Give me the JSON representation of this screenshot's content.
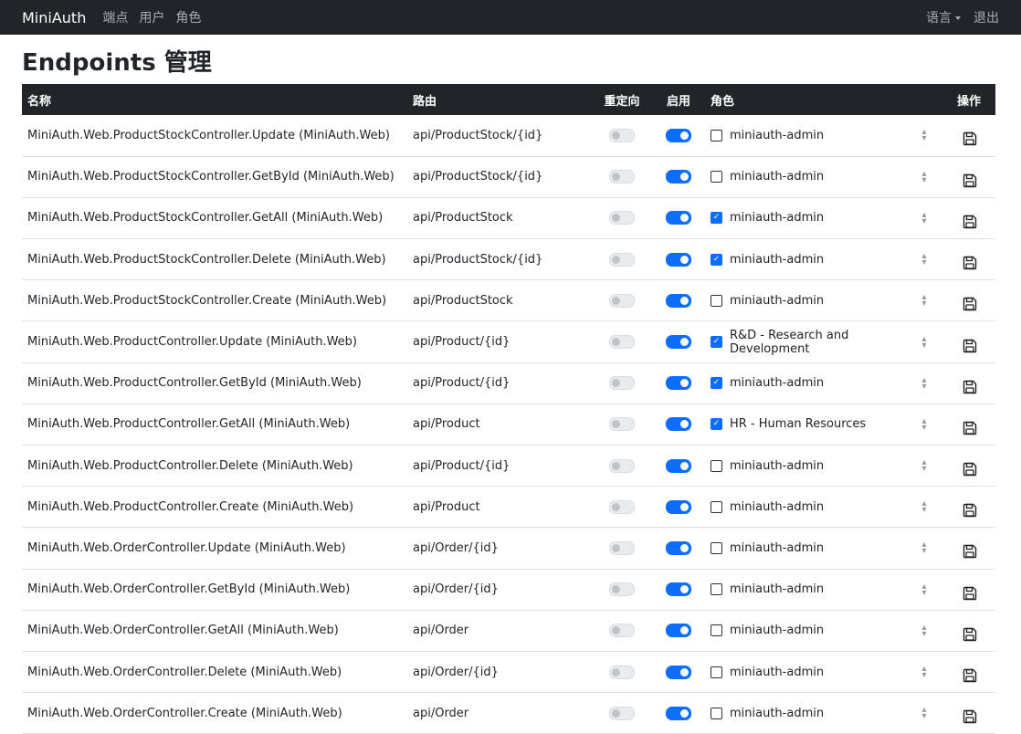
{
  "nav": {
    "brand": "MiniAuth",
    "links": [
      "端点",
      "用户",
      "角色"
    ],
    "language": "语言",
    "logout": "退出"
  },
  "page_title": "Endpoints 管理",
  "table": {
    "headers": {
      "name": "名称",
      "route": "路由",
      "redirect": "重定向",
      "enable": "启用",
      "role": "角色",
      "action": "操作"
    },
    "rows": [
      {
        "name": "MiniAuth.Web.ProductStockController.Update (MiniAuth.Web)",
        "route": "api/ProductStock/{id}",
        "redirect": false,
        "enabled": true,
        "role_checked": false,
        "role": "miniauth-admin"
      },
      {
        "name": "MiniAuth.Web.ProductStockController.GetById (MiniAuth.Web)",
        "route": "api/ProductStock/{id}",
        "redirect": false,
        "enabled": true,
        "role_checked": false,
        "role": "miniauth-admin"
      },
      {
        "name": "MiniAuth.Web.ProductStockController.GetAll (MiniAuth.Web)",
        "route": "api/ProductStock",
        "redirect": false,
        "enabled": true,
        "role_checked": true,
        "role": "miniauth-admin"
      },
      {
        "name": "MiniAuth.Web.ProductStockController.Delete (MiniAuth.Web)",
        "route": "api/ProductStock/{id}",
        "redirect": false,
        "enabled": true,
        "role_checked": true,
        "role": "miniauth-admin"
      },
      {
        "name": "MiniAuth.Web.ProductStockController.Create (MiniAuth.Web)",
        "route": "api/ProductStock",
        "redirect": false,
        "enabled": true,
        "role_checked": false,
        "role": "miniauth-admin"
      },
      {
        "name": "MiniAuth.Web.ProductController.Update (MiniAuth.Web)",
        "route": "api/Product/{id}",
        "redirect": false,
        "enabled": true,
        "role_checked": true,
        "role": "R&D - Research and Development"
      },
      {
        "name": "MiniAuth.Web.ProductController.GetById (MiniAuth.Web)",
        "route": "api/Product/{id}",
        "redirect": false,
        "enabled": true,
        "role_checked": true,
        "role": "miniauth-admin"
      },
      {
        "name": "MiniAuth.Web.ProductController.GetAll (MiniAuth.Web)",
        "route": "api/Product",
        "redirect": false,
        "enabled": true,
        "role_checked": true,
        "role": "HR - Human Resources"
      },
      {
        "name": "MiniAuth.Web.ProductController.Delete (MiniAuth.Web)",
        "route": "api/Product/{id}",
        "redirect": false,
        "enabled": true,
        "role_checked": false,
        "role": "miniauth-admin"
      },
      {
        "name": "MiniAuth.Web.ProductController.Create (MiniAuth.Web)",
        "route": "api/Product",
        "redirect": false,
        "enabled": true,
        "role_checked": false,
        "role": "miniauth-admin"
      },
      {
        "name": "MiniAuth.Web.OrderController.Update (MiniAuth.Web)",
        "route": "api/Order/{id}",
        "redirect": false,
        "enabled": true,
        "role_checked": false,
        "role": "miniauth-admin"
      },
      {
        "name": "MiniAuth.Web.OrderController.GetById (MiniAuth.Web)",
        "route": "api/Order/{id}",
        "redirect": false,
        "enabled": true,
        "role_checked": false,
        "role": "miniauth-admin"
      },
      {
        "name": "MiniAuth.Web.OrderController.GetAll (MiniAuth.Web)",
        "route": "api/Order",
        "redirect": false,
        "enabled": true,
        "role_checked": false,
        "role": "miniauth-admin"
      },
      {
        "name": "MiniAuth.Web.OrderController.Delete (MiniAuth.Web)",
        "route": "api/Order/{id}",
        "redirect": false,
        "enabled": true,
        "role_checked": false,
        "role": "miniauth-admin"
      },
      {
        "name": "MiniAuth.Web.OrderController.Create (MiniAuth.Web)",
        "route": "api/Order",
        "redirect": false,
        "enabled": true,
        "role_checked": false,
        "role": "miniauth-admin"
      }
    ]
  },
  "icons": {
    "save": "save-icon",
    "spinner": "select-arrows-icon"
  },
  "colors": {
    "navbar": "#212529",
    "accent": "#0d6efd"
  }
}
